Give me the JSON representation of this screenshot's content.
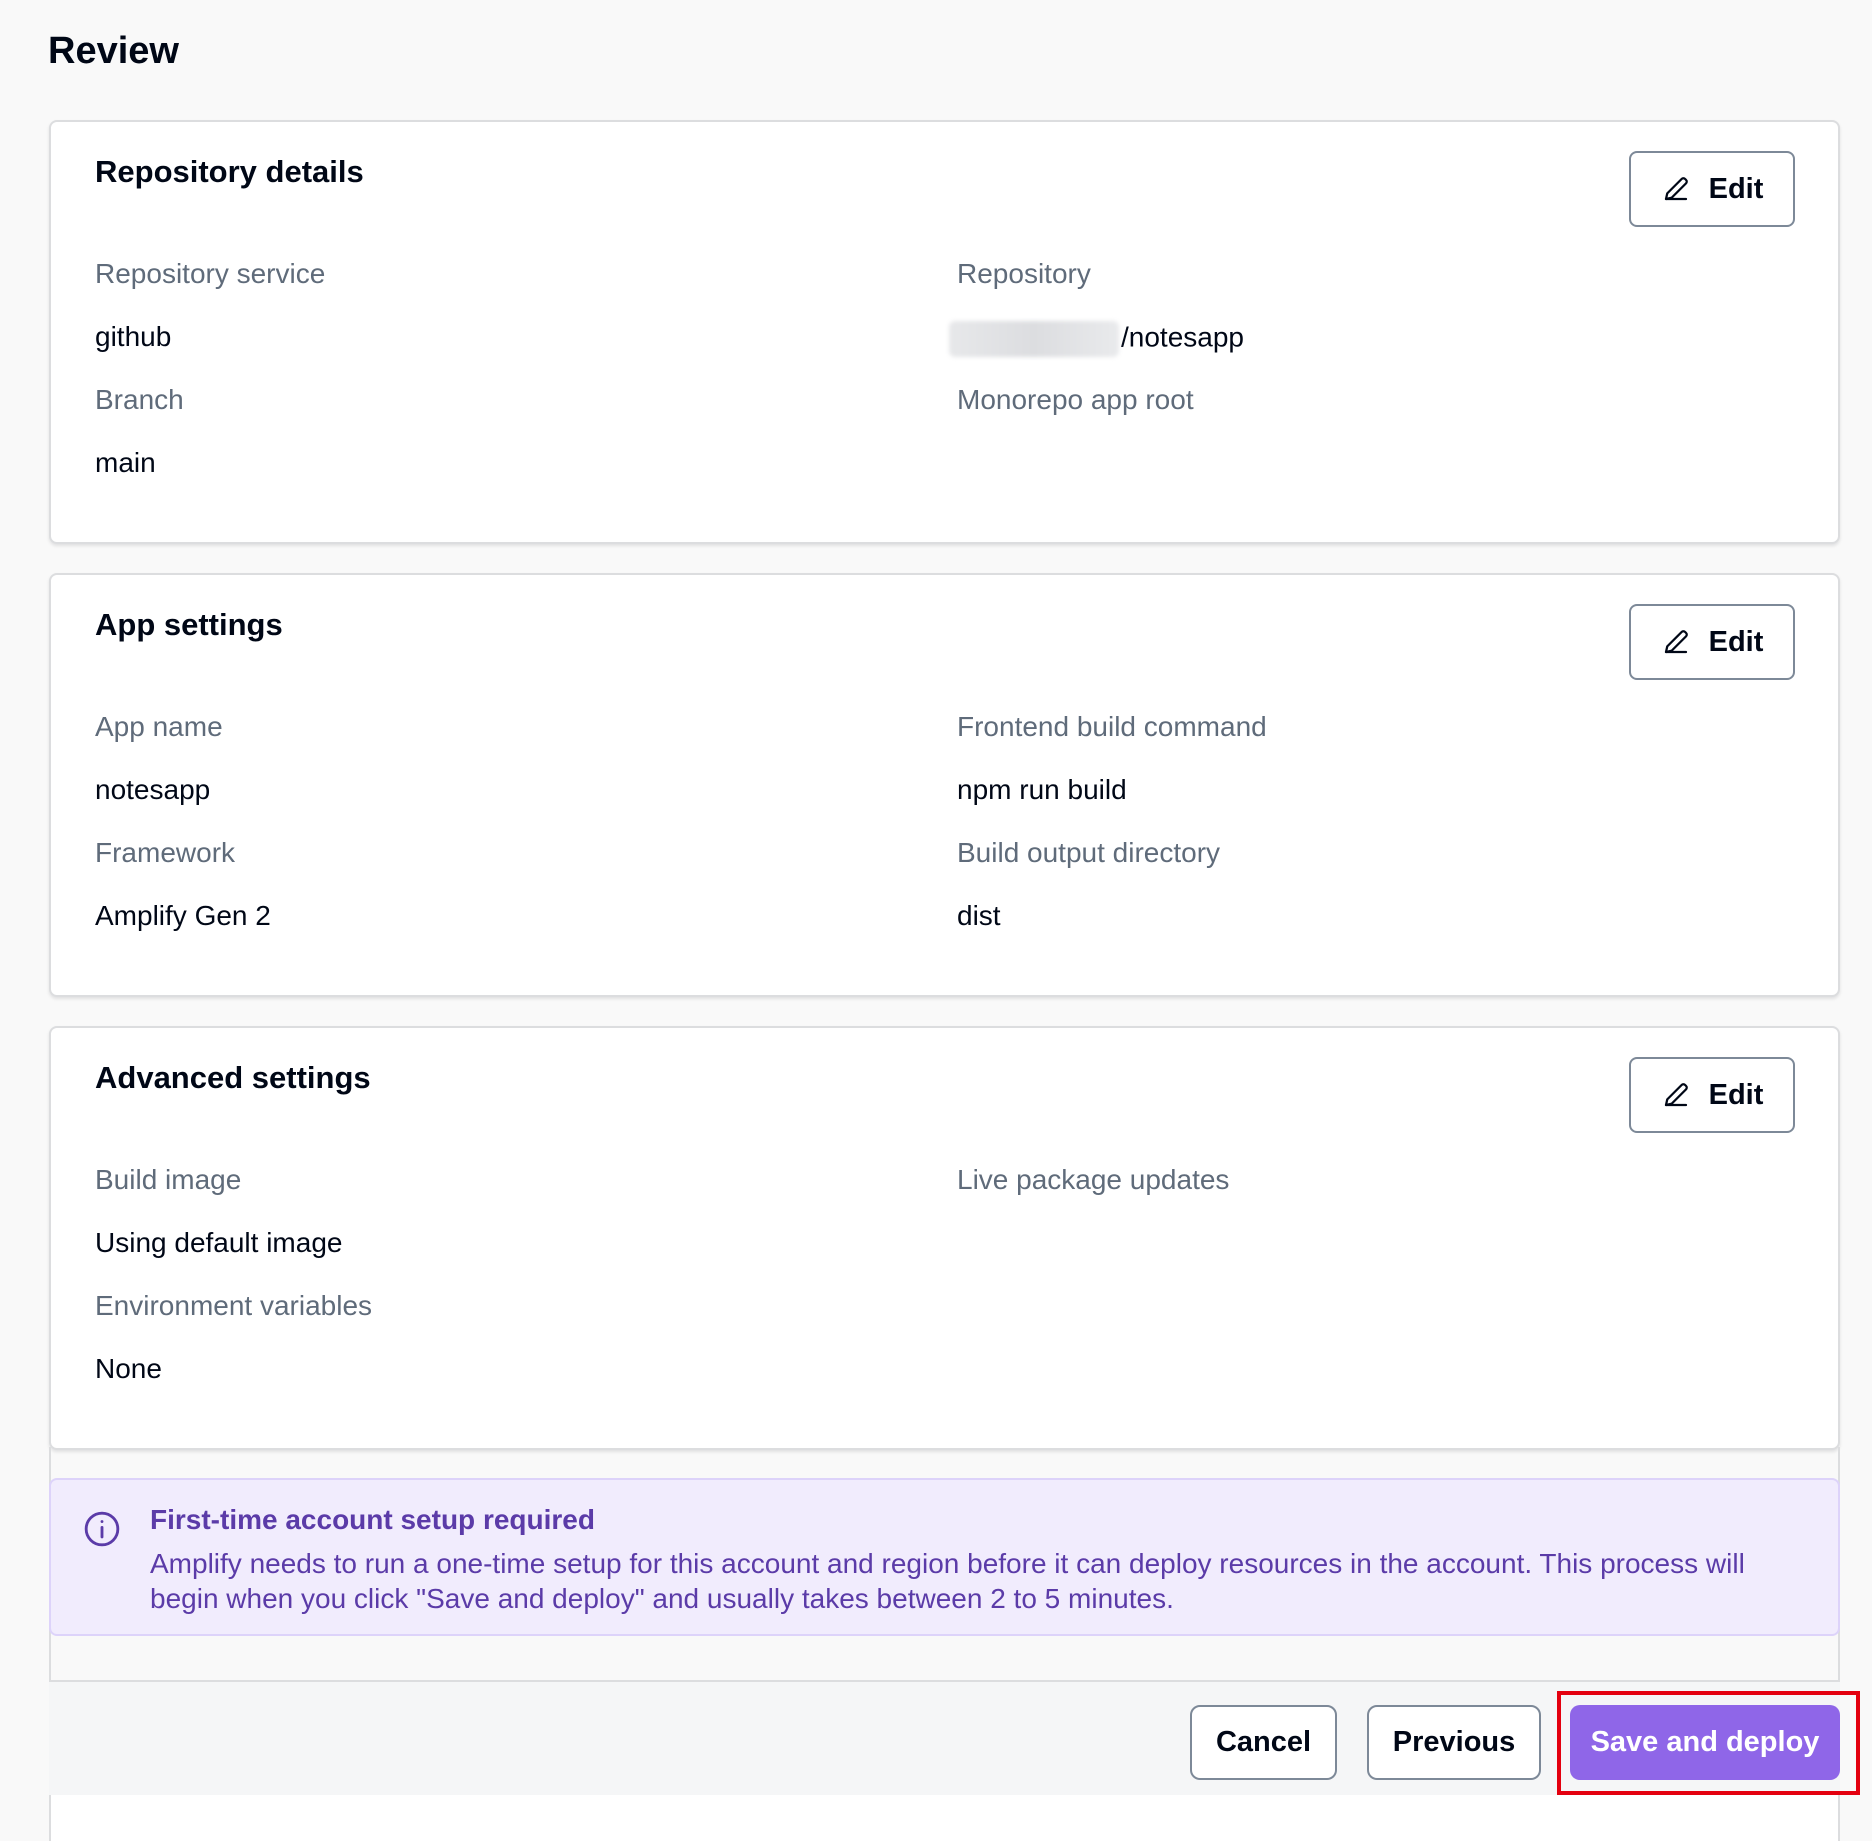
{
  "page": {
    "title": "Review"
  },
  "sections": {
    "repository": {
      "title": "Repository details",
      "edit_label": "Edit",
      "fields": {
        "service_label": "Repository service",
        "service_value": "github",
        "repository_label": "Repository",
        "repository_value": "/notesapp",
        "branch_label": "Branch",
        "branch_value": "main",
        "monorepo_label": "Monorepo app root"
      }
    },
    "app_settings": {
      "title": "App settings",
      "edit_label": "Edit",
      "fields": {
        "app_name_label": "App name",
        "app_name_value": "notesapp",
        "build_command_label": "Frontend build command",
        "build_command_value": "npm run build",
        "framework_label": "Framework",
        "framework_value": "Amplify Gen 2",
        "output_dir_label": "Build output directory",
        "output_dir_value": "dist"
      }
    },
    "advanced": {
      "title": "Advanced settings",
      "edit_label": "Edit",
      "fields": {
        "build_image_label": "Build image",
        "build_image_value": "Using default image",
        "live_updates_label": "Live package updates",
        "env_vars_label": "Environment variables",
        "env_vars_value": "None"
      }
    }
  },
  "alert": {
    "title": "First-time account setup required",
    "body": "Amplify needs to run a one-time setup for this account and region before it can deploy resources in the account. This process will begin when you click \"Save and deploy\" and usually takes between 2 to 5 minutes.",
    "icon": "info-icon"
  },
  "footer": {
    "cancel_label": "Cancel",
    "previous_label": "Previous",
    "save_label": "Save and deploy"
  },
  "colors": {
    "primary": "#8f66e8",
    "alert_text": "#5b3ba8",
    "alert_bg": "#f1ecfd",
    "highlight": "#e4000f",
    "label_grey": "#5f6b7a"
  }
}
